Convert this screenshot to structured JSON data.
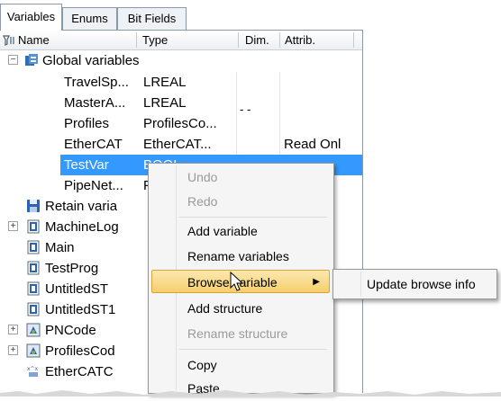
{
  "tabs": [
    {
      "label": "Variables",
      "active": true
    },
    {
      "label": "Enums",
      "active": false
    },
    {
      "label": "Bit Fields",
      "active": false
    }
  ],
  "columns": {
    "name": "Name",
    "type": "Type",
    "dim": "Dim.",
    "attrib": "Attrib."
  },
  "filter_icon": "filter-icon",
  "tree": {
    "global_group": "Global variables",
    "global_items": [
      {
        "name": "TravelSp...",
        "type": "LREAL",
        "dim": "",
        "attrib": ""
      },
      {
        "name": "MasterA...",
        "type": "LREAL",
        "dim": "- -",
        "attrib": ""
      },
      {
        "name": "Profiles",
        "type": "ProfilesCo...",
        "dim": "",
        "attrib": ""
      },
      {
        "name": "EtherCAT",
        "type": "EtherCAT...",
        "dim": "",
        "attrib": "Read Onl"
      },
      {
        "name": "TestVar",
        "type": "BOOL",
        "dim": "",
        "attrib": ""
      },
      {
        "name": "PipeNet...",
        "type": "F",
        "dim": "",
        "attrib": ""
      }
    ],
    "nodes": [
      {
        "name": "Retain varia",
        "icon": "retain-disk-icon"
      },
      {
        "name": "MachineLog",
        "icon": "program-unit-icon"
      },
      {
        "name": "Main",
        "icon": "program-unit-icon"
      },
      {
        "name": "TestProg",
        "icon": "program-unit-icon"
      },
      {
        "name": "UntitledST",
        "icon": "program-unit-icon"
      },
      {
        "name": "UntitledST1",
        "icon": "program-unit-icon"
      },
      {
        "name": "PNCode",
        "icon": "network-unit-icon"
      },
      {
        "name": "ProfilesCod",
        "icon": "network-unit-icon"
      },
      {
        "name": "EtherCATC",
        "icon": "ethercat-icon"
      }
    ]
  },
  "context_menu": {
    "items": [
      {
        "label": "Undo",
        "disabled": true
      },
      {
        "label": "Redo",
        "disabled": true
      },
      {
        "label": "Add variable",
        "disabled": false
      },
      {
        "label": "Rename variables",
        "disabled": false
      },
      {
        "label": "Browse variable",
        "disabled": false,
        "hover": true,
        "submenu": true
      },
      {
        "label": "Add structure",
        "disabled": false
      },
      {
        "label": "Rename structure",
        "disabled": true
      },
      {
        "label": "Copy",
        "disabled": false
      },
      {
        "label": "Paste",
        "disabled": false
      }
    ],
    "submenu": {
      "label": "Update browse info"
    }
  },
  "colors": {
    "selection": "#3399ff",
    "menu_hover": "#f6cf6c",
    "panel_border": "#8b98a8"
  }
}
